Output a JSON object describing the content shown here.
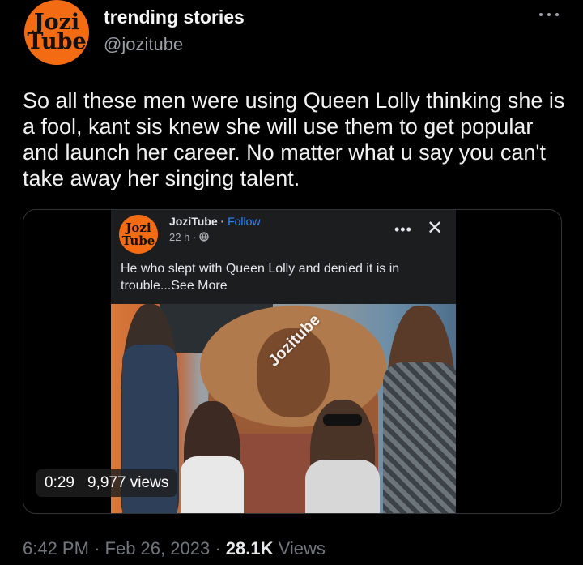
{
  "account": {
    "display_name": "trending stories",
    "handle": "@jozitube",
    "logo_line1": "Jozi",
    "logo_line2": "Tube"
  },
  "tweet": {
    "text": "So all these men were using Queen Lolly thinking she is a fool, kant sis knew she will use them to get popular and launch her career. No matter what u say you can't take away her singing talent."
  },
  "media": {
    "embedded_post": {
      "page_name": "JoziTube",
      "follow_label": "Follow",
      "time": "22 h",
      "text": "He who slept with Queen Lolly and denied it is in trouble...See More",
      "logo_line1": "Jozi",
      "logo_line2": "Tube",
      "watermark": "Jozitube"
    },
    "duration": "0:29",
    "views": "9,977 views"
  },
  "meta": {
    "time": "6:42 PM",
    "separator": "·",
    "date": "Feb 26, 2023",
    "views_count": "28.1K",
    "views_label": "Views"
  },
  "icons": [
    "more-options-icon",
    "globe-icon",
    "close-icon",
    "dots-icon"
  ],
  "colors": {
    "background": "#000000",
    "brand_orange": "#f36b13",
    "link_blue": "#2d88ff",
    "muted": "#71767b"
  }
}
